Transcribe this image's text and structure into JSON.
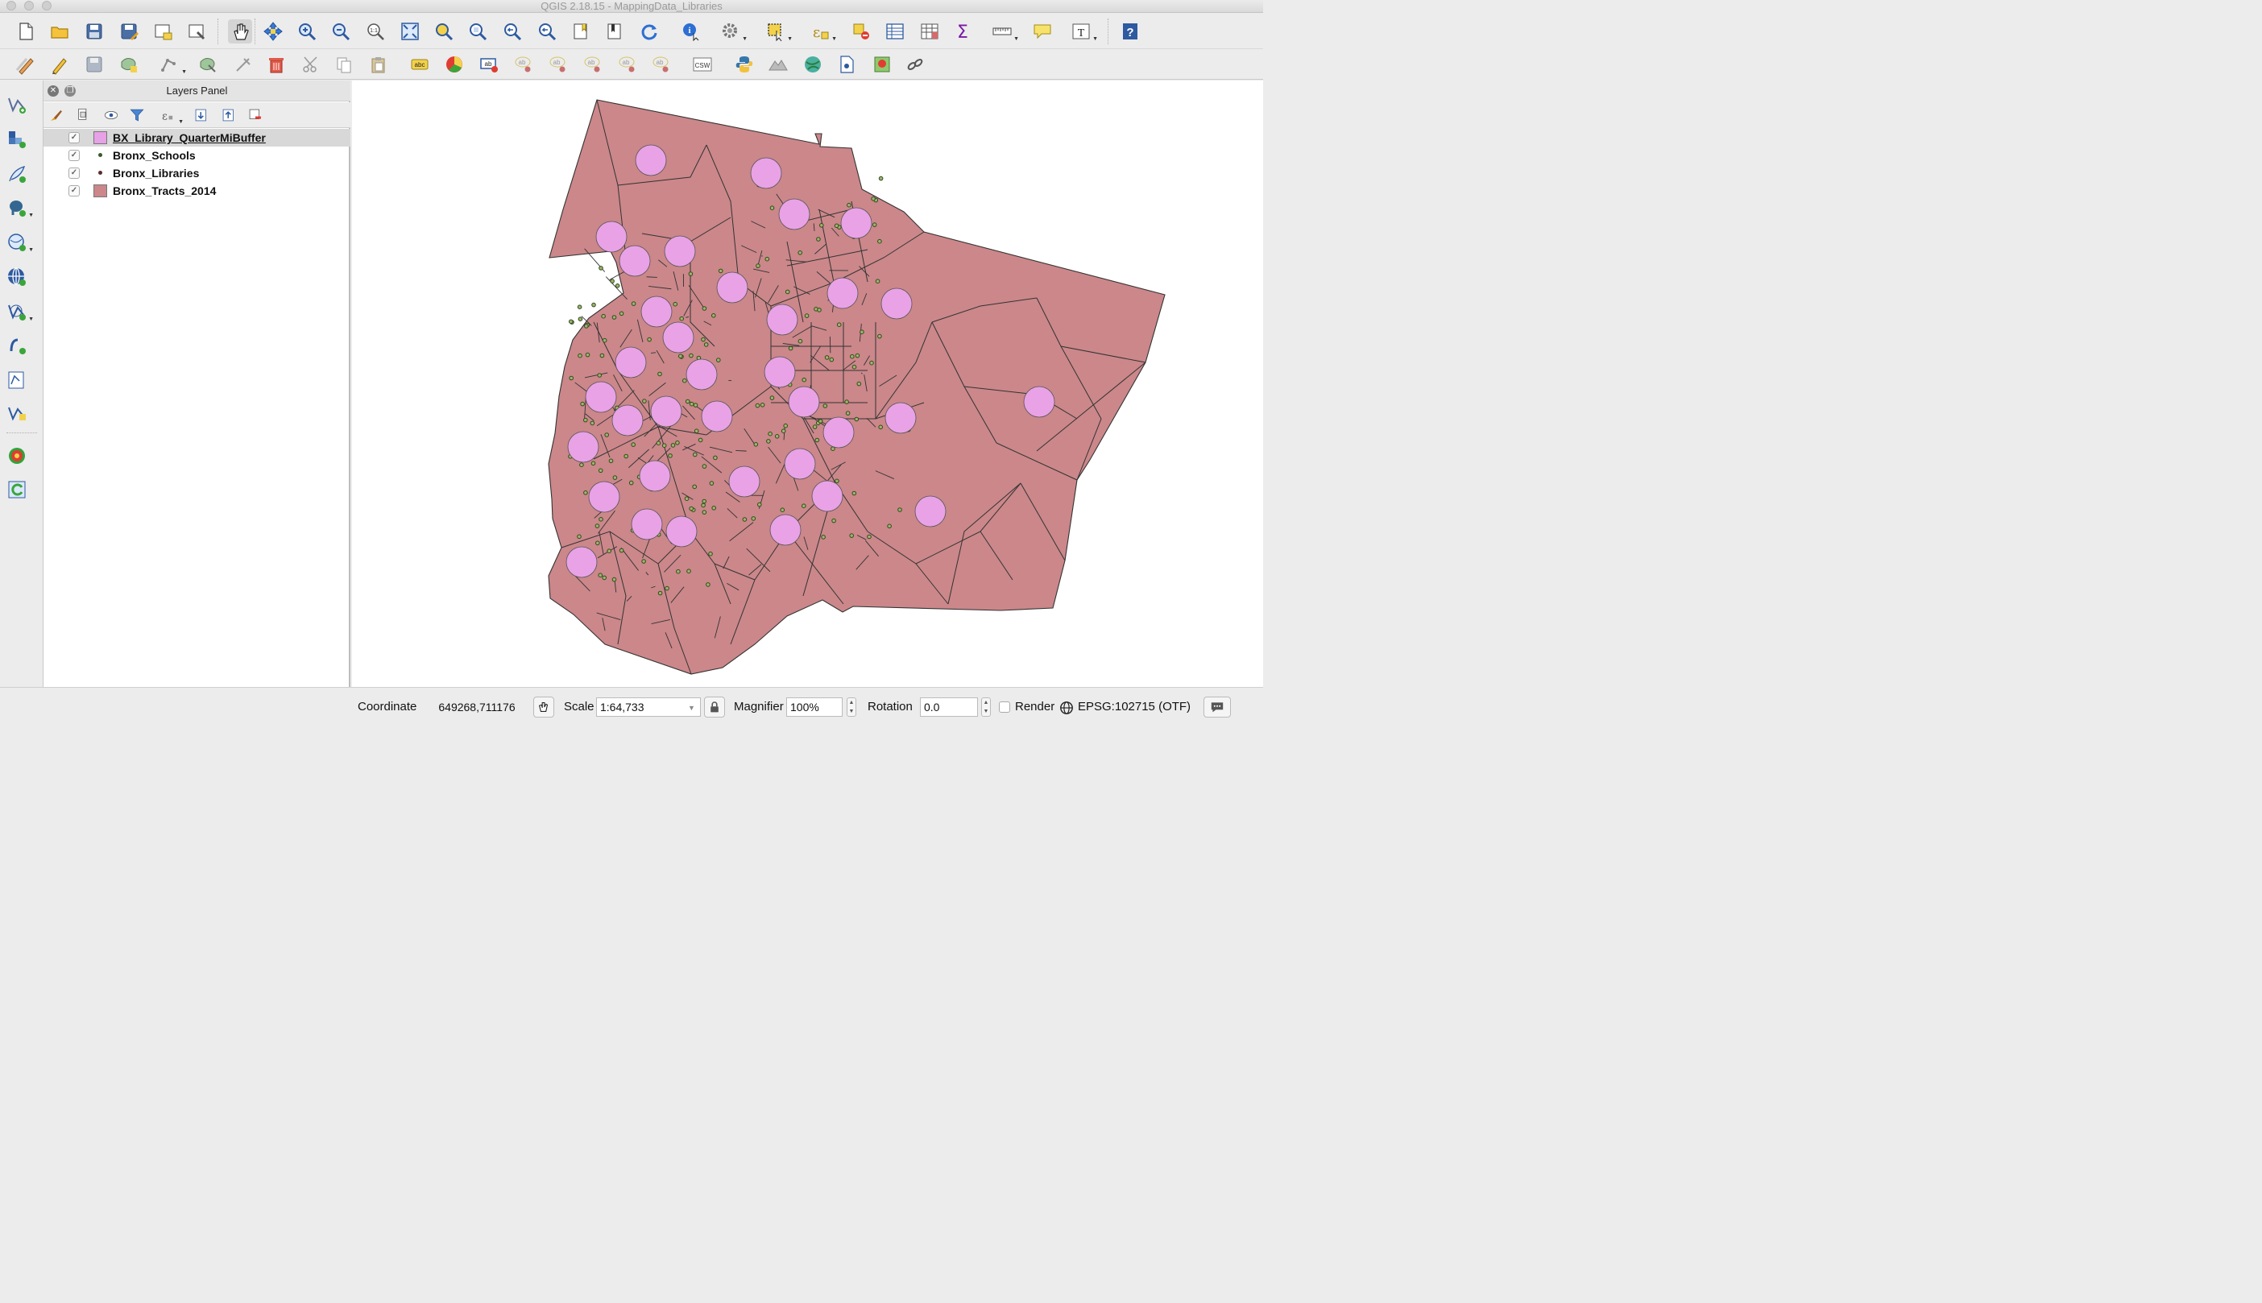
{
  "window": {
    "title": "QGIS 2.18.15 - MappingData_Libraries"
  },
  "toolbar": {
    "row1": [
      "new-project-icon",
      "open-project-icon",
      "save-project-icon",
      "save-as-icon",
      "new-print-composer-icon",
      "composer-manager-icon",
      "pan-map-icon",
      "pan-to-selection-icon",
      "zoom-in-icon",
      "zoom-out-icon",
      "zoom-actual-size-icon",
      "zoom-full-icon",
      "zoom-to-selection-icon",
      "zoom-to-layer-icon",
      "zoom-last-icon",
      "zoom-next-icon",
      "new-bookmark-icon",
      "show-bookmarks-icon",
      "refresh-icon",
      "identify-icon",
      "run-action-icon",
      "select-features-icon",
      "select-by-expression-icon",
      "deselect-icon",
      "attribute-table-icon",
      "field-calculator-icon",
      "statistics-icon",
      "measure-icon",
      "map-tips-icon",
      "text-annotation-icon",
      "help-icon"
    ],
    "row2": [
      "current-edits-icon",
      "toggle-editing-icon",
      "save-edits-icon",
      "add-feature-icon",
      "digitize-icon",
      "vertex-tool-icon",
      "node-tool-icon",
      "delete-selected-icon",
      "cut-features-icon",
      "copy-features-icon",
      "paste-features-icon",
      "label-icon",
      "diagram-icon",
      "pin-labels-icon",
      "show-hide-labels-icon",
      "preview-labels-icon",
      "move-label-icon",
      "rotate-label-icon",
      "change-label-icon",
      "csw-icon",
      "python-console-icon",
      "raster-terrain-icon",
      "plugin-globe-icon",
      "plugin-layer-icon",
      "georeferencer-icon",
      "plugin-link-icon"
    ],
    "csw_label": "CSW"
  },
  "sidebar": {
    "items": [
      "add-vector-layer-icon",
      "add-raster-layer-icon",
      "add-delimited-text-icon",
      "add-postgis-icon",
      "add-spatialite-icon",
      "add-wms-icon",
      "add-wfs-icon",
      "add-wcs-icon",
      "new-shapefile-icon",
      "new-spatialite-icon",
      "new-temp-layer-icon",
      "plugin-heatmap-icon",
      "plugin-refresh-icon"
    ]
  },
  "layers_panel": {
    "title": "Layers Panel",
    "tools": [
      "style-icon",
      "add-group-icon",
      "manage-visibility-icon",
      "filter-legend-icon",
      "filter-expression-icon",
      "expand-all-icon",
      "collapse-all-icon",
      "remove-layer-icon"
    ],
    "layers": [
      {
        "name": "BX_Library_QuarterMiBuffer",
        "checked": true,
        "symbol": "fill",
        "color": "#e7a1e6",
        "selected": true
      },
      {
        "name": "Bronx_Schools",
        "checked": true,
        "symbol": "point",
        "color": "#3a5a2a",
        "selected": false
      },
      {
        "name": "Bronx_Libraries",
        "checked": true,
        "symbol": "point",
        "color": "#5a2d2d",
        "selected": false
      },
      {
        "name": "Bronx_Tracts_2014",
        "checked": true,
        "symbol": "fill",
        "color": "#cb878a",
        "selected": false
      }
    ]
  },
  "map": {
    "tract_color": "#cb878a",
    "buffer_color": "#e9a2e6",
    "school_color": "#2e4a1f"
  },
  "status": {
    "coordinate_label": "Coordinate",
    "coordinate_value": "649268,711176",
    "scale_label": "Scale",
    "scale_value": "1:64,733",
    "magnifier_label": "Magnifier",
    "magnifier_value": "100%",
    "rotation_label": "Rotation",
    "rotation_value": "0.0",
    "render_label": "Render",
    "render_checked": false,
    "crs_label": "EPSG:102715 (OTF)"
  }
}
